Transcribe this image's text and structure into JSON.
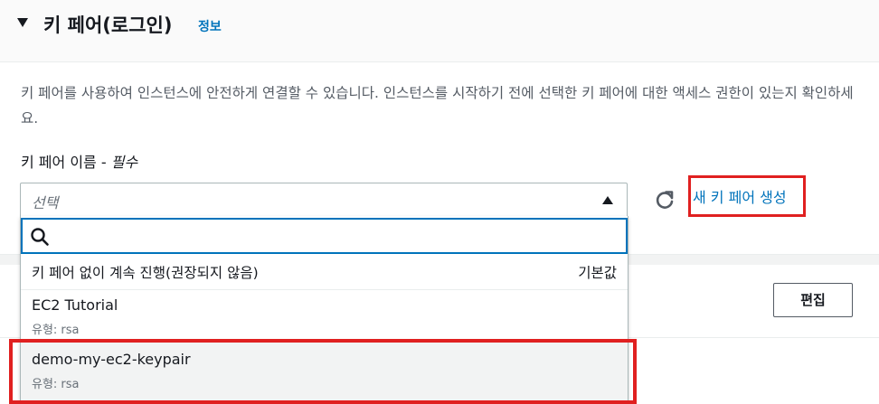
{
  "section": {
    "title": "키 페어(로그인)",
    "info_link": "정보",
    "description": "키 페어를 사용하여 인스턴스에 안전하게 연결할 수 있습니다. 인스턴스를 시작하기 전에 선택한 키 페어에 대한 액세스 권한이 있는지 확인하세요."
  },
  "field": {
    "label": "키 페어 이름 - ",
    "required": "필수",
    "select_placeholder": "선택",
    "new_key_link": "새 키 페어 생성"
  },
  "dropdown": {
    "search_value": "",
    "options": [
      {
        "label": "키 페어 없이 계속 진행(권장되지 않음)",
        "tag": "기본값"
      },
      {
        "label": "EC2 Tutorial",
        "sub": "유형: rsa"
      },
      {
        "label": "demo-my-ec2-keypair",
        "sub": "유형: rsa"
      }
    ]
  },
  "background": {
    "edit_button": "편집"
  },
  "colors": {
    "link": "#0073bb",
    "highlight": "#e02020",
    "focus": "#0073bb"
  }
}
